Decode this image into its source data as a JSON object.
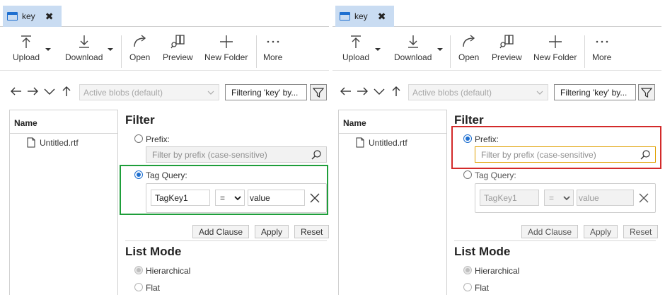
{
  "colors": {
    "tab_bg": "#c9dcf2",
    "accent": "#1e6fd0",
    "highlight_green": "#1e9e3a",
    "highlight_red": "#d32a2a",
    "focus_border": "#e0a000"
  },
  "panes": [
    {
      "tab": {
        "title": "key",
        "close_glyph": "✖",
        "icon": "window-icon"
      },
      "toolbar": {
        "upload": "Upload",
        "download": "Download",
        "open": "Open",
        "preview": "Preview",
        "new_folder": "New Folder",
        "more": "More"
      },
      "nav": {
        "blob_select": "Active blobs (default)",
        "filter_text": "Filtering 'key' by..."
      },
      "list": {
        "header": "Name",
        "items": [
          "Untitled.rtf"
        ]
      },
      "filter": {
        "title": "Filter",
        "prefix_label": "Prefix:",
        "prefix_placeholder": "Filter by prefix (case-sensitive)",
        "tag_query_label": "Tag Query:",
        "tag_key": "TagKey1",
        "tag_operator": "=",
        "tag_value": "value",
        "selected": "tag_query",
        "add_clause": "Add Clause",
        "apply": "Apply",
        "reset": "Reset"
      },
      "list_mode": {
        "title": "List Mode",
        "hierarchical": "Hierarchical",
        "flat": "Flat"
      }
    },
    {
      "tab": {
        "title": "key",
        "close_glyph": "✖",
        "icon": "window-icon"
      },
      "toolbar": {
        "upload": "Upload",
        "download": "Download",
        "open": "Open",
        "preview": "Preview",
        "new_folder": "New Folder",
        "more": "More"
      },
      "nav": {
        "blob_select": "Active blobs (default)",
        "filter_text": "Filtering 'key' by..."
      },
      "list": {
        "header": "Name",
        "items": [
          "Untitled.rtf"
        ]
      },
      "filter": {
        "title": "Filter",
        "prefix_label": "Prefix:",
        "prefix_placeholder": "Filter by prefix (case-sensitive)",
        "tag_query_label": "Tag Query:",
        "tag_key": "TagKey1",
        "tag_operator": "=",
        "tag_value": "value",
        "selected": "prefix",
        "add_clause": "Add Clause",
        "apply": "Apply",
        "reset": "Reset"
      },
      "list_mode": {
        "title": "List Mode",
        "hierarchical": "Hierarchical",
        "flat": "Flat"
      }
    }
  ]
}
